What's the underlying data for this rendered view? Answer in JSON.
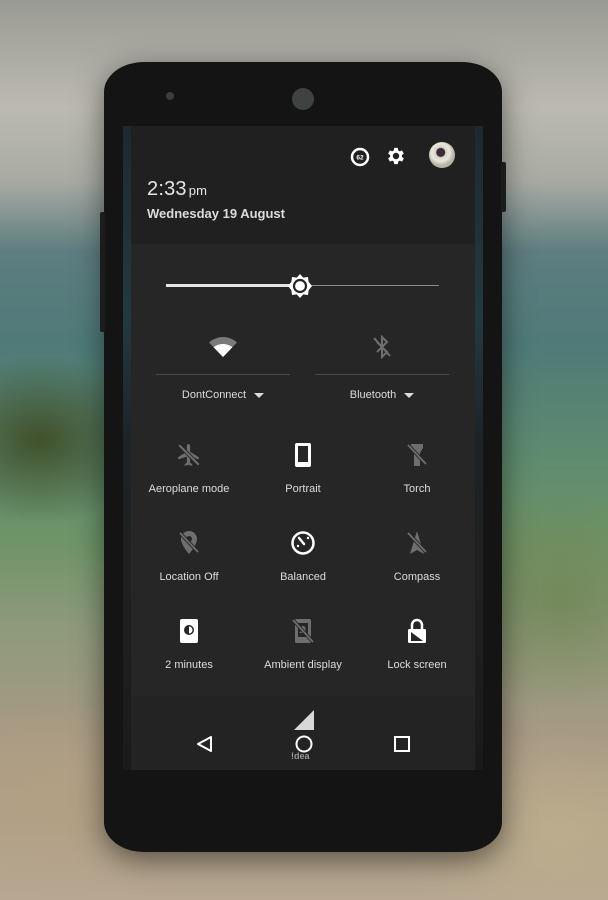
{
  "status": {
    "battery_level": "62",
    "time": "2:33",
    "ampm": "pm",
    "date": "Wednesday 19 August",
    "carrier": "!dea"
  },
  "brightness": {
    "level": 0.49
  },
  "connections": {
    "wifi": {
      "label": "DontConnect",
      "icon": "wifi-icon",
      "state": "on"
    },
    "bluetooth": {
      "label": "Bluetooth",
      "icon": "bluetooth-disabled-icon",
      "state": "off"
    }
  },
  "tiles": [
    {
      "label": "Aeroplane mode",
      "icon": "airplane-off-icon",
      "state": "off"
    },
    {
      "label": "Portrait",
      "icon": "portrait-icon",
      "state": "on"
    },
    {
      "label": "Torch",
      "icon": "torch-off-icon",
      "state": "off"
    },
    {
      "label": "Location Off",
      "icon": "location-off-icon",
      "state": "off"
    },
    {
      "label": "Balanced",
      "icon": "performance-gauge-icon",
      "state": "on"
    },
    {
      "label": "Compass",
      "icon": "compass-off-icon",
      "state": "off"
    },
    {
      "label": "2 minutes",
      "icon": "screen-timeout-icon",
      "state": "on"
    },
    {
      "label": "Ambient display",
      "icon": "ambient-display-off-icon",
      "state": "off"
    },
    {
      "label": "Lock screen",
      "icon": "lock-screen-icon",
      "state": "on"
    }
  ],
  "colors": {
    "active_icon": "#ffffff",
    "inactive_icon": "#6e6e6e",
    "panel_bg": "#262626",
    "header_bg": "#202020"
  }
}
